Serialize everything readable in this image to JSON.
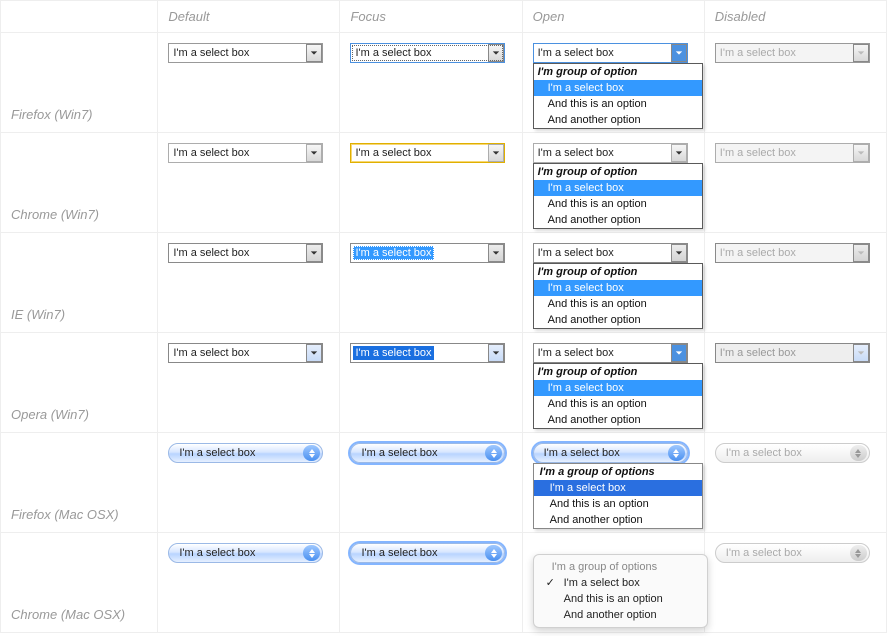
{
  "columns": {
    "c1": "Default",
    "c2": "Focus",
    "c3": "Open",
    "c4": "Disabled"
  },
  "rows": {
    "r1": "Firefox (Win7)",
    "r2": "Chrome (Win7)",
    "r3": "IE (Win7)",
    "r4": "Opera (Win7)",
    "r5": "Firefox (Mac OSX)",
    "r6": "Chrome (Mac OSX)"
  },
  "select": {
    "value": "I'm a select box"
  },
  "dropdown_win": {
    "group": "I'm group of option",
    "opt1": "I'm a select box",
    "opt2": "And this is an option",
    "opt3": "And another option"
  },
  "dropdown_mac": {
    "group": "I'm a group of options",
    "opt1": "I'm a select box",
    "opt2": "And this is an option",
    "opt3": "And another option"
  }
}
